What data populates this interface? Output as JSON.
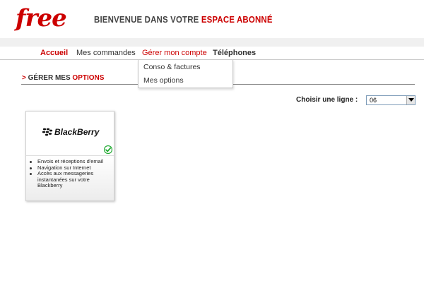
{
  "header": {
    "logo_text": "free",
    "welcome_prefix": "BIENVENUE DANS VOTRE ",
    "welcome_accent": "ESPACE ABONNÉ"
  },
  "nav": {
    "items": [
      {
        "label": "Accueil"
      },
      {
        "label": "Mes commandes"
      },
      {
        "label": "Gérer mon compte"
      },
      {
        "label": "Téléphones"
      }
    ],
    "dropdown": [
      {
        "label": "Conso & factures"
      },
      {
        "label": "Mes options"
      }
    ]
  },
  "section": {
    "arrow": ">",
    "prefix": " GÉRER MES ",
    "accent": "OPTIONS"
  },
  "line_selector": {
    "label": "Choisir une ligne :",
    "value": "06"
  },
  "card": {
    "brand": "BlackBerry",
    "features": [
      "Envois et réceptions d'email",
      "Navigation sur Internet",
      "Accès aux messageries instantanées sur votre Blackberry"
    ]
  },
  "colors": {
    "accent": "#cc0000",
    "check": "#22aa33"
  }
}
